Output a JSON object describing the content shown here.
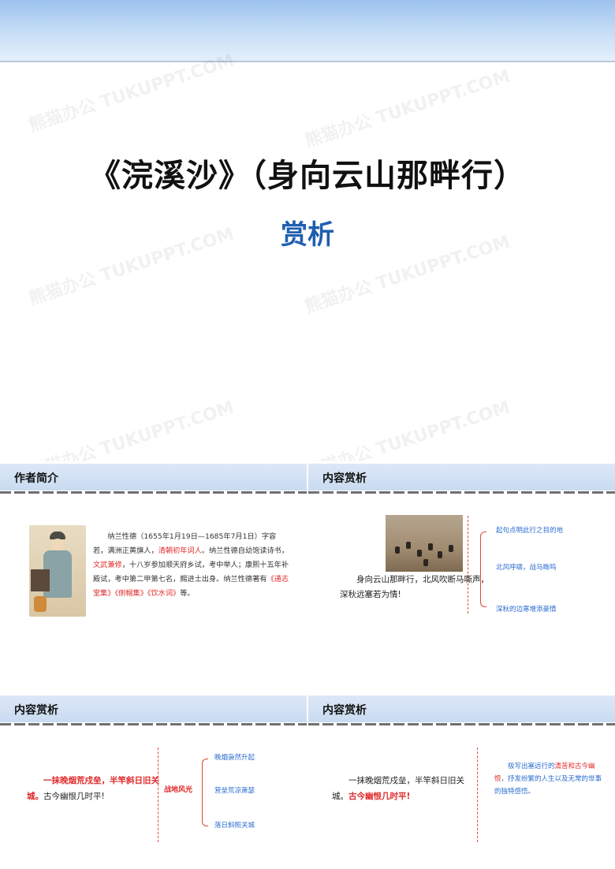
{
  "cover": {
    "title": "《浣溪沙》（身向云山那畔行）",
    "subtitle": "赏析"
  },
  "slide_author": {
    "header": "作者简介",
    "bio_parts": [
      "纳兰性德（1655年1月19日—1685年7月1日）字容若，满洲正黄旗人，",
      "清朝初年词人",
      "。纳兰性德自幼饱读诗书，",
      "文武兼修",
      "，十八岁参加顺天府乡试，考中举人；康熙十五年补殿试，考中第二甲第七名，赐进士出身。纳兰性德著有",
      "《通志堂集》《侧帽集》《饮水词》",
      "等。"
    ]
  },
  "slide_content_1": {
    "header": "内容赏析",
    "verse": "身向云山那畔行，北风吹断马嘶声，深秋远塞若为情!",
    "notes": [
      "起句点明此行之目的地",
      "北风呼啸，战马嘶鸣",
      "深秋的边寒增添豪情"
    ]
  },
  "slide_content_2": {
    "header": "内容赏析",
    "verse_red": "一抹晚烟荒戍垒，半竿斜日旧关城",
    "verse_period": "。",
    "verse_rest": "古今幽恨几时平!",
    "label": "战地风光",
    "notes": [
      "晚烟袅然升起",
      "营垒荒凉萧瑟",
      "落日斜照关城"
    ]
  },
  "slide_content_3": {
    "header": "内容赏析",
    "verse_plain": "一抹晚烟荒戍垒，半竿斜日旧关城。",
    "verse_red": "古今幽恨几时平!",
    "analysis_parts": [
      "极写出塞远行的",
      "清苦和古今幽恨",
      "，抒发纷繁的人生以及无常的世事的独特感悟。"
    ]
  }
}
